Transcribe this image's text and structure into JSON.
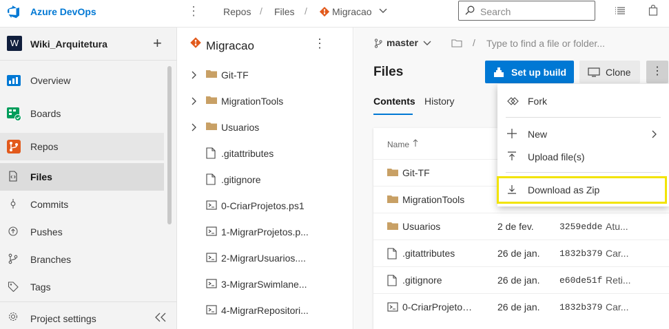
{
  "topbar": {
    "brand": "Azure DevOps",
    "crumbs": [
      "Repos",
      "Files",
      "Migracao"
    ],
    "search_placeholder": "Search"
  },
  "project": {
    "initial": "W",
    "name": "Wiki_Arquitetura"
  },
  "nav": {
    "overview": "Overview",
    "boards": "Boards",
    "repos": "Repos",
    "files": "Files",
    "commits": "Commits",
    "pushes": "Pushes",
    "branches": "Branches",
    "tags": "Tags",
    "settings": "Project settings"
  },
  "tree": {
    "repo": "Migracao",
    "items": [
      {
        "name": "Git-TF",
        "type": "folder"
      },
      {
        "name": "MigrationTools",
        "type": "folder"
      },
      {
        "name": "Usuarios",
        "type": "folder"
      },
      {
        "name": ".gitattributes",
        "type": "file"
      },
      {
        "name": ".gitignore",
        "type": "file"
      },
      {
        "name": "0-CriarProjetos.ps1",
        "type": "script"
      },
      {
        "name": "1-MigrarProjetos.p...",
        "type": "script"
      },
      {
        "name": "2-MigrarUsuarios....",
        "type": "script"
      },
      {
        "name": "3-MigrarSwimlane...",
        "type": "script"
      },
      {
        "name": "4-MigrarRepositori...",
        "type": "script"
      }
    ]
  },
  "main": {
    "branch": "master",
    "path_placeholder": "Type to find a file or folder...",
    "title": "Files",
    "setup_build": "Set up build",
    "clone": "Clone",
    "tabs": [
      "Contents",
      "History"
    ],
    "col_name": "Name",
    "rows": [
      {
        "name": "Git-TF",
        "type": "folder",
        "date": "",
        "commit": "",
        "msg": ""
      },
      {
        "name": "MigrationTools",
        "type": "folder",
        "date": "",
        "commit": "",
        "msg": ""
      },
      {
        "name": "Usuarios",
        "type": "folder",
        "date": "2 de fev.",
        "commit": "3259edde",
        "msg": "Atu..."
      },
      {
        "name": ".gitattributes",
        "type": "file",
        "date": "26 de jan.",
        "commit": "1832b379",
        "msg": "Car..."
      },
      {
        "name": ".gitignore",
        "type": "file",
        "date": "26 de jan.",
        "commit": "e60de51f",
        "msg": "Reti..."
      },
      {
        "name": "0-CriarProjetos....",
        "type": "script",
        "date": "26 de jan.",
        "commit": "1832b379",
        "msg": "Car..."
      }
    ]
  },
  "menu": {
    "fork": "Fork",
    "new": "New",
    "upload": "Upload file(s)",
    "download": "Download as Zip"
  },
  "colors": {
    "accent": "#0078d4",
    "highlight": "#f2e400",
    "git": "#e25a1c"
  }
}
